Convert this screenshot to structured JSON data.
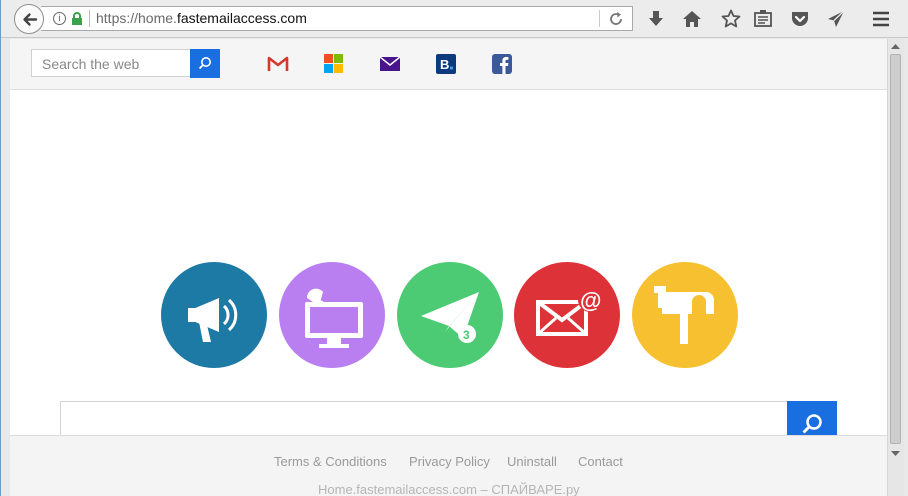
{
  "browser": {
    "url_prefix": "https://home.",
    "url_domain": "fastemailaccess.com",
    "info_glyph": "i",
    "toolbar_icons": [
      "download-icon",
      "home-icon",
      "bookmark-star-icon",
      "reading-list-icon",
      "pocket-icon",
      "send-icon",
      "hamburger-menu-icon"
    ]
  },
  "topbar": {
    "search_placeholder": "Search the web",
    "quick_links": [
      "gmail-icon",
      "microsoft-icon",
      "yahoo-mail-icon",
      "booking-icon",
      "facebook-icon"
    ]
  },
  "tiles": [
    {
      "name": "announcement-tile",
      "icon": "megaphone-icon",
      "color": "#1c7aa5"
    },
    {
      "name": "computer-tile",
      "icon": "monitor-bell-icon",
      "color": "#b97ff0"
    },
    {
      "name": "send-tile",
      "icon": "paper-plane-icon",
      "color": "#4ccb74",
      "badge": "3"
    },
    {
      "name": "email-tile",
      "icon": "envelope-at-icon",
      "color": "#dd3238"
    },
    {
      "name": "mailbox-tile",
      "icon": "mailbox-icon",
      "color": "#f6c030"
    }
  ],
  "footer": {
    "links": [
      "Terms & Conditions",
      "Privacy Policy",
      "Uninstall",
      "Contact"
    ],
    "subtext": "Home.fastemailaccess.com – СПАЙВАРЕ.ру"
  },
  "colors": {
    "accent": "#1a6fe0"
  }
}
